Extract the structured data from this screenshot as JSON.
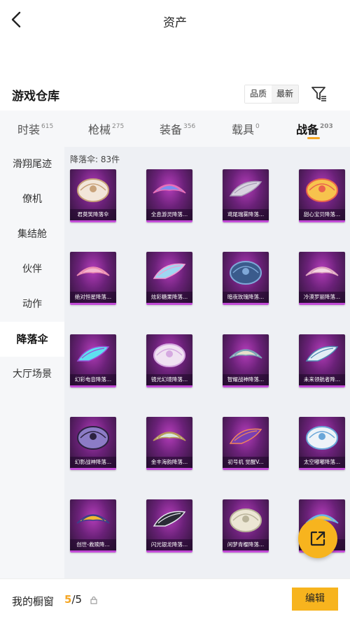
{
  "header": {
    "title": "资产"
  },
  "section": {
    "title": "游戏仓库",
    "sort_options": [
      "品质",
      "最新"
    ]
  },
  "tabs": [
    {
      "label": "时装",
      "count": "615"
    },
    {
      "label": "枪械",
      "count": "275"
    },
    {
      "label": "装备",
      "count": "356"
    },
    {
      "label": "载具",
      "count": "0"
    },
    {
      "label": "战备",
      "count": "203"
    }
  ],
  "sidebar": {
    "items": [
      "滑翔尾迹",
      "僚机",
      "集结舱",
      "伙伴",
      "动作",
      "降落伞",
      "大厅场景"
    ],
    "active": "降落伞"
  },
  "content": {
    "count_label": "降落伞: 83件",
    "items": [
      {
        "label": "君莫笑降落伞",
        "colors": [
          "#f2e6d9",
          "#c8a27a"
        ]
      },
      {
        "label": "全息游灵降落...",
        "colors": [
          "#7c8ef0",
          "#e86fb8"
        ]
      },
      {
        "label": "鸢尾瑞雾降落...",
        "colors": [
          "#d9d3e0",
          "#a89cb6"
        ]
      },
      {
        "label": "甜心宝贝降落...",
        "colors": [
          "#f7c34d",
          "#e9634d"
        ]
      },
      {
        "label": "绝对恒星降落...",
        "colors": [
          "#f4b6cf",
          "#ec8db1"
        ]
      },
      {
        "label": "炫彩糖果降落...",
        "colors": [
          "#9fd7f2",
          "#f29ad0"
        ]
      },
      {
        "label": "暗夜玫瑰降落...",
        "colors": [
          "#3a5b8c",
          "#7fa8d8"
        ]
      },
      {
        "label": "冷漠罗丽降落...",
        "colors": [
          "#f4d8e4",
          "#dfa6c0"
        ]
      },
      {
        "label": "幻彩电音降落...",
        "colors": [
          "#5ee1f0",
          "#9a4fd6"
        ]
      },
      {
        "label": "镜光幻境降落...",
        "colors": [
          "#f0e2f2",
          "#d5a9e0"
        ]
      },
      {
        "label": "智耀战神降落...",
        "colors": [
          "#e7e0c9",
          "#7aa4b8"
        ]
      },
      {
        "label": "未来领航者降...",
        "colors": [
          "#e3eef5",
          "#4f87b3"
        ]
      },
      {
        "label": "幻影战神降落...",
        "colors": [
          "#8c7cc6",
          "#2c2240"
        ]
      },
      {
        "label": "金丰海韵降落...",
        "colors": [
          "#d9e8df",
          "#b89a5a"
        ]
      },
      {
        "label": "初号机 觉醒V...",
        "colors": [
          "#7a3fb2",
          "#f2845a"
        ]
      },
      {
        "label": "太空嘟嘟降落...",
        "colors": [
          "#eef3f8",
          "#6aa6d8"
        ]
      },
      {
        "label": "创世-救赎降...",
        "colors": [
          "#f2b933",
          "#3b3f8a"
        ]
      },
      {
        "label": "闪光银龙降落...",
        "colors": [
          "#2b2b36",
          "#e6e6ee"
        ]
      },
      {
        "label": "闲梦青樱降落...",
        "colors": [
          "#ece6d4",
          "#b9b39a"
        ]
      },
      {
        "label": "",
        "colors": [
          "#f2c94c",
          "#6ab7e8"
        ]
      }
    ]
  },
  "bottom": {
    "window_label": "我的橱窗",
    "window_current": "5",
    "window_total": "/5",
    "edit_label": "编辑"
  },
  "colors": {
    "accent": "#f7b41e",
    "card_purple": "#6a2178",
    "card_border": "#c14ad6"
  },
  "icons": {
    "back": "chevron-left-icon",
    "filter": "filter-icon",
    "share": "share-external-icon",
    "lock": "lock-icon"
  }
}
